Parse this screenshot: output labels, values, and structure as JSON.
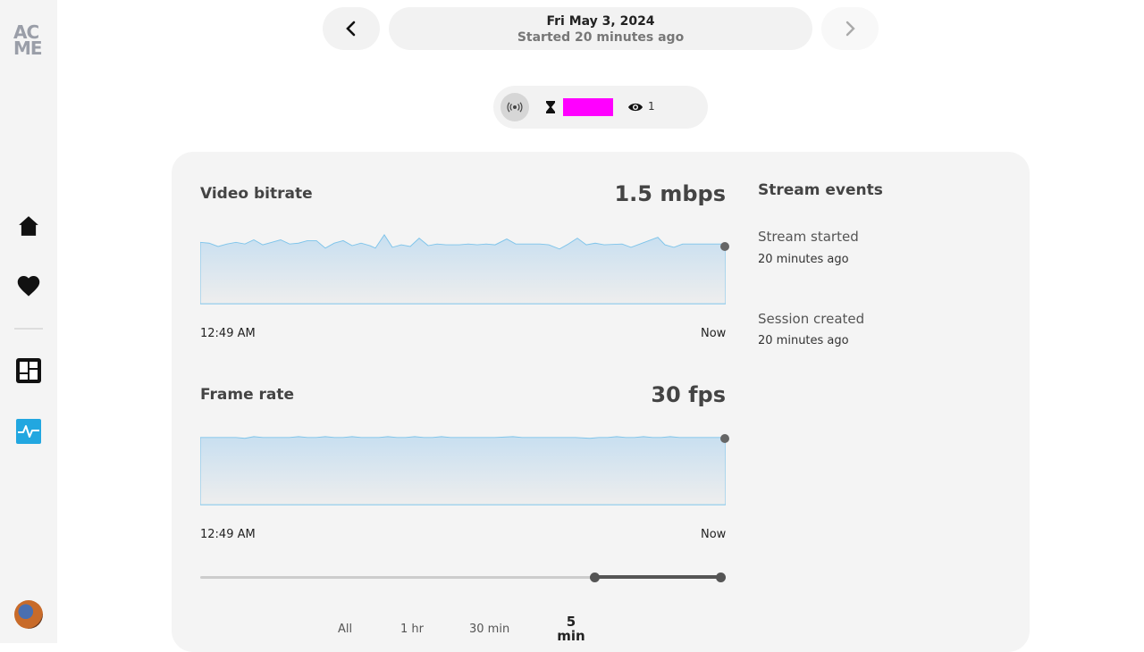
{
  "logo": {
    "line1": "AC",
    "line2": "ME"
  },
  "sidebar": {
    "items": [
      {
        "name": "home",
        "icon": "home-icon"
      },
      {
        "name": "favorites",
        "icon": "heart-icon"
      },
      {
        "name": "dashboard",
        "icon": "dashboard-icon"
      },
      {
        "name": "activity",
        "icon": "activity-icon",
        "active": true
      }
    ]
  },
  "header": {
    "date": "Fri May 3, 2024",
    "started": "Started 20 minutes ago"
  },
  "status": {
    "viewers": "1",
    "live_icon": "broadcast-icon",
    "host_icon": "hourglass-icon"
  },
  "metrics": {
    "bitrate": {
      "title": "Video bitrate",
      "value": "1.5 mbps",
      "start_label": "12:49 AM",
      "end_label": "Now"
    },
    "framerate": {
      "title": "Frame rate",
      "value": "30 fps",
      "start_label": "12:49 AM",
      "end_label": "Now"
    }
  },
  "events": {
    "title": "Stream events",
    "items": [
      {
        "name": "Stream started",
        "time": "20 minutes ago"
      },
      {
        "name": "Session created",
        "time": "20 minutes ago"
      }
    ]
  },
  "range": {
    "options": [
      "All",
      "1 hr",
      "30 min",
      "5 min"
    ],
    "selected": "5 min"
  },
  "colors": {
    "accent": "#22a7e0",
    "chart_line": "#7ec4ea",
    "panel": "#f4f4f4"
  }
}
